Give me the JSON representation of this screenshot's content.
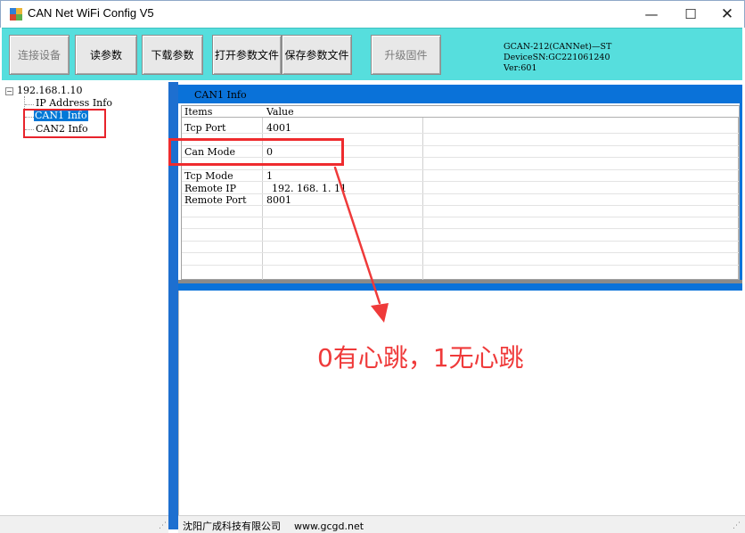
{
  "window": {
    "title": "CAN Net WiFi Config V5",
    "minimize": "—",
    "maximize": "☐",
    "close": "✕"
  },
  "toolbar": {
    "buttons": [
      {
        "label": "连接设备",
        "disabled": true
      },
      {
        "label": "读参数",
        "disabled": false
      },
      {
        "label": "下载参数",
        "disabled": false
      },
      {
        "label": "打开参数文件",
        "disabled": false
      },
      {
        "label": "保存参数文件",
        "disabled": false
      },
      {
        "label": "升级固件",
        "disabled": true
      }
    ],
    "device_info": {
      "line1": "GCAN-212(CANNet)—ST",
      "line2": "DeviceSN:GC221061240",
      "line3": "Ver:601"
    }
  },
  "tree": {
    "root": "192.168.1.10",
    "children": [
      "IP Address Info",
      "CAN1 Info",
      "CAN2 Info"
    ],
    "selected": "CAN1 Info",
    "toggle": "−"
  },
  "panel": {
    "title": "CAN1 Info",
    "columns": [
      "Items",
      "Value"
    ],
    "rows": [
      {
        "item": "Tcp Port",
        "value": "4001"
      },
      {
        "item": "Can Mode",
        "value": "0"
      },
      {
        "item": "Tcp Mode",
        "value": "1"
      },
      {
        "item": "Remote IP",
        "value": "192. 168. 1. 11"
      },
      {
        "item": "Remote Port",
        "value": "8001"
      }
    ]
  },
  "annotation": {
    "text": "0有心跳，1无心跳",
    "color": "#ef3a3a"
  },
  "status": {
    "company": "沈阳广成科技有限公司",
    "website": "www.gcgd.net"
  },
  "colors": {
    "toolbar_bg": "#56dedd",
    "accent_blue": "#0a72d9",
    "highlight_red": "#e8232b",
    "selection": "#0078d7"
  }
}
